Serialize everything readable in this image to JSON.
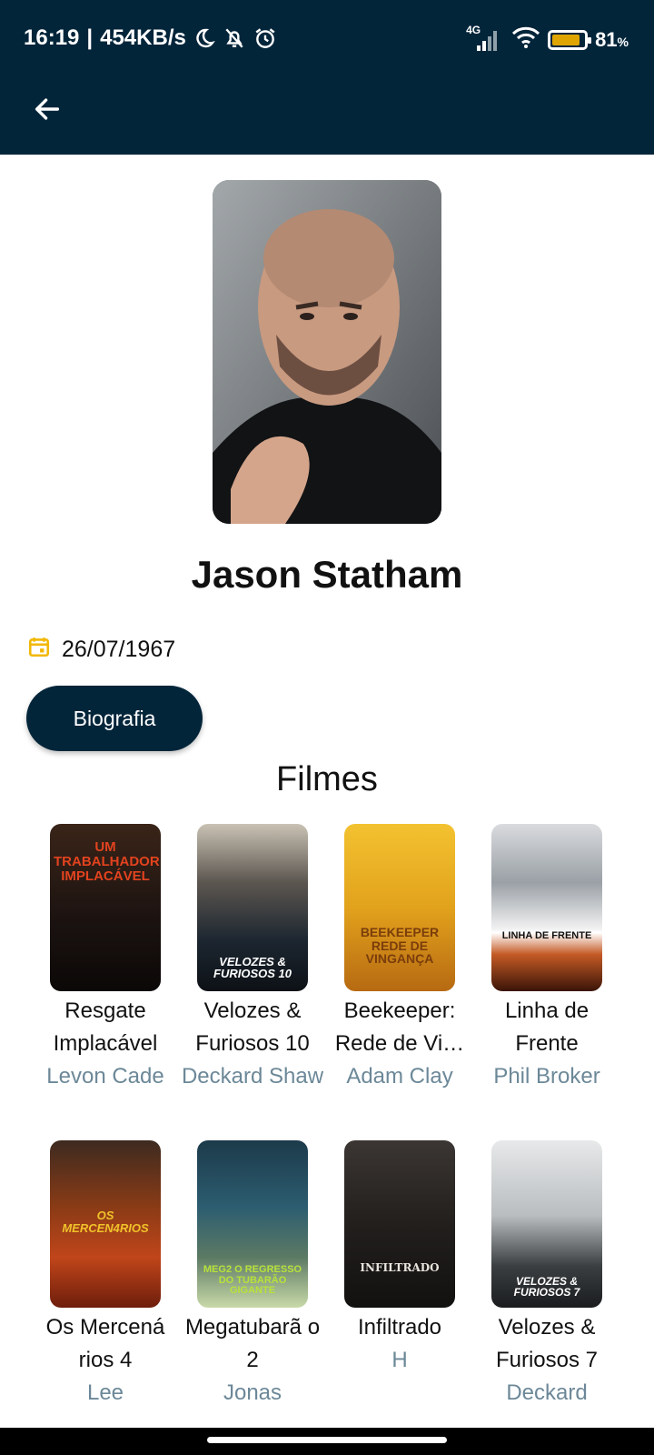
{
  "status": {
    "time": "16:19",
    "speed": "454KB/s",
    "network": "4G",
    "battery": "81",
    "battery_unit": "%"
  },
  "person": {
    "name": "Jason Statham",
    "birth_date": "26/07/1967"
  },
  "actions": {
    "bio_label": "Biografia"
  },
  "movies_section": {
    "title": "Filmes"
  },
  "movies": [
    {
      "title": "Resgate Implacável",
      "role": "Levon Cade",
      "poster_text": "UM TRABALHADOR IMPLACÁVEL"
    },
    {
      "title": "Velozes & Furiosos 10",
      "role": "Deckard Shaw",
      "poster_text": "VELOZES & FURIOSOS 10"
    },
    {
      "title": "Beekeeper: Rede de Vi…",
      "role": "Adam Clay",
      "poster_text": "BEEKEEPER REDE DE VINGANÇA"
    },
    {
      "title": "Linha de Frente",
      "role": "Phil Broker",
      "poster_text": "LINHA DE FRENTE"
    },
    {
      "title": "Os Mercená rios 4",
      "role": "Lee",
      "poster_text": "OS MERCEN4RIOS"
    },
    {
      "title": "Megatubarã o 2",
      "role": "Jonas",
      "poster_text": "MEG2 O REGRESSO DO TUBARÃO GIGANTE"
    },
    {
      "title": "Infiltrado",
      "role": "H",
      "poster_text": "INFILTRADO"
    },
    {
      "title": "Velozes & Furiosos 7",
      "role": "Deckard",
      "poster_text": "VELOZES & FURIOSOS 7"
    }
  ],
  "colors": {
    "appbar": "#03253a",
    "accent_calendar": "#f2b705",
    "role_text": "#6c8898"
  }
}
